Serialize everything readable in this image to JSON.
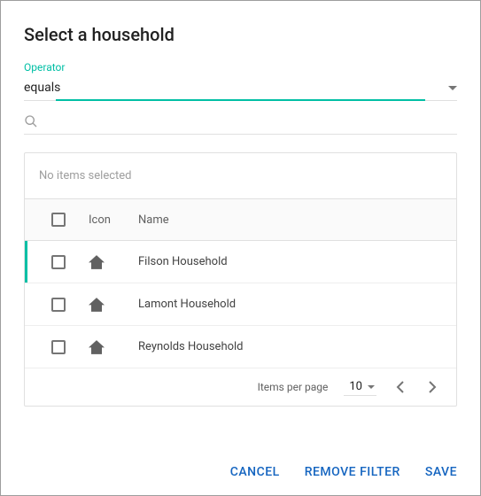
{
  "title": "Select a household",
  "operator": {
    "label": "Operator",
    "value": "equals"
  },
  "search": {
    "placeholder": ""
  },
  "table": {
    "no_selection": "No items selected",
    "headers": {
      "icon": "Icon",
      "name": "Name"
    },
    "rows": [
      {
        "name": "Filson Household"
      },
      {
        "name": "Lamont Household"
      },
      {
        "name": "Reynolds Household"
      }
    ]
  },
  "pagination": {
    "items_per_page_label": "Items per page",
    "page_size": "10"
  },
  "actions": {
    "cancel": "CANCEL",
    "remove_filter": "REMOVE FILTER",
    "save": "SAVE"
  }
}
